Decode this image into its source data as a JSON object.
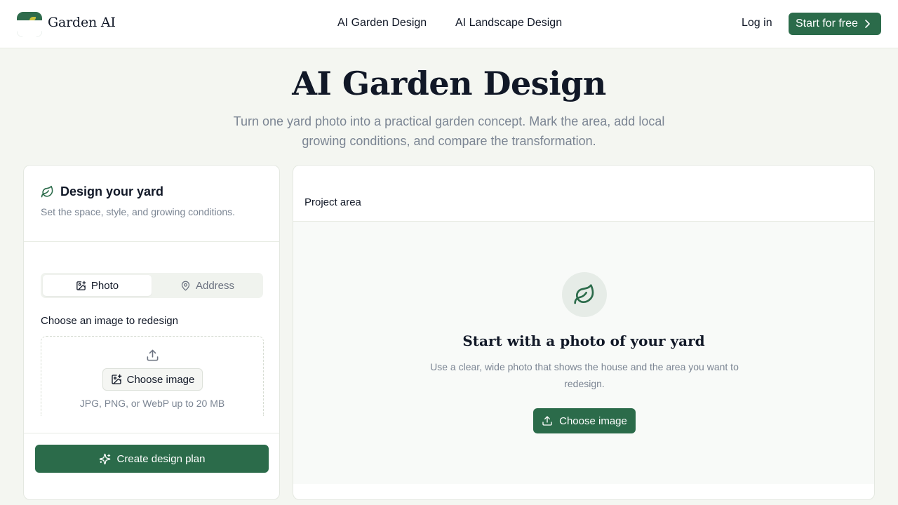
{
  "brand": {
    "name": "Garden AI",
    "logo_icon": "leaf-logo-icon",
    "accent": "#2b6b4a"
  },
  "nav": {
    "links": [
      "AI Garden Design",
      "AI Landscape Design"
    ],
    "login": "Log in",
    "cta": "Start for free",
    "cta_icon": "chevron-right-icon"
  },
  "hero": {
    "title": "AI Garden Design",
    "subtitle": "Turn one yard photo into a practical garden concept. Mark the area, add local growing conditions, and compare the transformation."
  },
  "design_panel": {
    "icon": "leaf-icon",
    "title": "Design your yard",
    "subtitle": "Set the space, style, and growing conditions.",
    "tabs": [
      {
        "label": "Photo",
        "icon": "image-plus-icon",
        "active": true
      },
      {
        "label": "Address",
        "icon": "map-pin-icon",
        "active": false
      }
    ],
    "upload_label": "Choose an image to redesign",
    "upload_icon": "upload-icon",
    "choose_button": "Choose image",
    "hint": "JPG, PNG, or WebP up to 20 MB",
    "create_button": "Create design plan",
    "create_icon": "sparkles-icon"
  },
  "project_panel": {
    "label": "Project area",
    "empty_icon": "leaf-icon",
    "empty_title": "Start with a photo of your yard",
    "empty_subtitle": "Use a clear, wide photo that shows the house and the area you want to redesign.",
    "empty_button": "Choose image",
    "empty_button_icon": "upload-icon"
  }
}
